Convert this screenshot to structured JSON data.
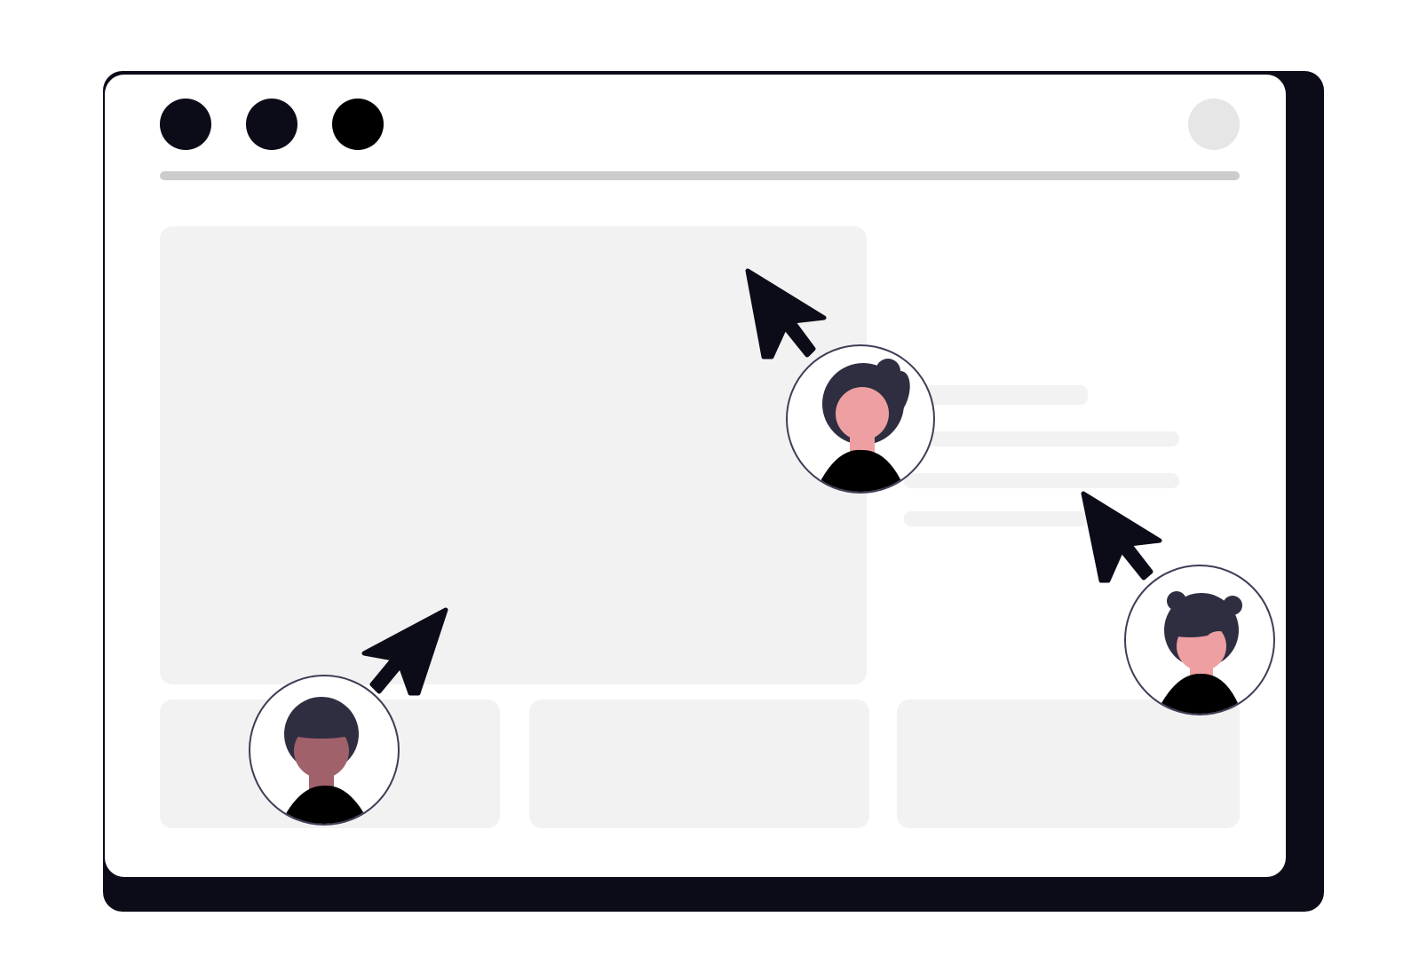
{
  "illustration": {
    "colors": {
      "page_background": "#ffffff",
      "window_frame": "#0c0b18",
      "window_fill": "#ffffff",
      "placeholder_fill": "#f2f2f2",
      "address_bar": "#cccccc",
      "profile_placeholder": "#e6e6e6",
      "cursor": "#0c0b18",
      "hair": "#2f2e41",
      "skin_light": "#ee9fa1",
      "skin_dark": "#a0616a",
      "shirt": "#000000"
    },
    "window_controls": [
      "close-dot",
      "minimize-dot",
      "maximize-dot"
    ],
    "collaborators": [
      {
        "id": "collaborator-left",
        "cursor": "cursor-pointer-icon"
      },
      {
        "id": "collaborator-center",
        "cursor": "cursor-pointer-icon"
      },
      {
        "id": "collaborator-right",
        "cursor": "cursor-pointer-icon"
      }
    ]
  }
}
